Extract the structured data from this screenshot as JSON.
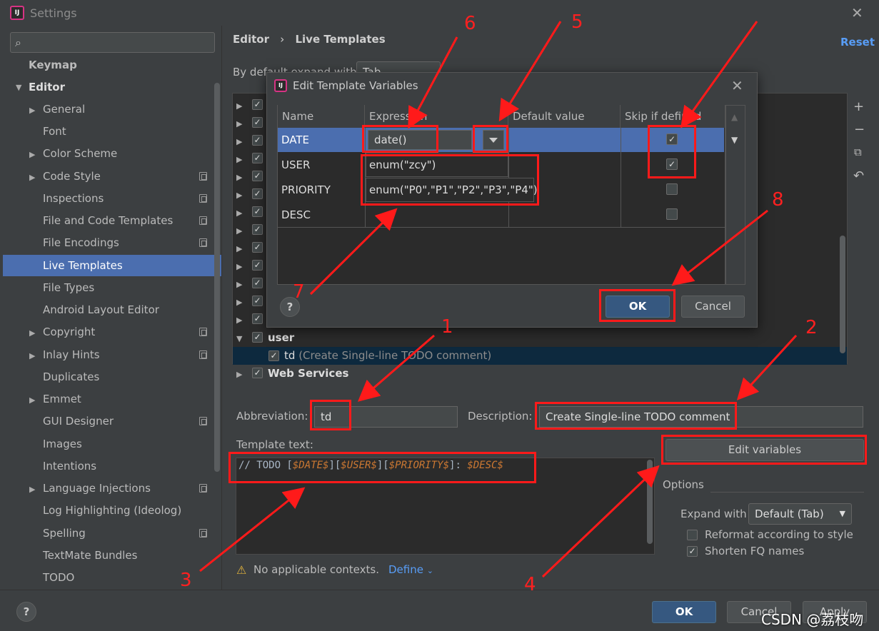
{
  "window": {
    "title": "Settings"
  },
  "sidebar": {
    "search_placeholder": "",
    "items": [
      {
        "label": "Keymap"
      },
      {
        "label": "Editor"
      },
      {
        "label": "General"
      },
      {
        "label": "Font"
      },
      {
        "label": "Color Scheme"
      },
      {
        "label": "Code Style"
      },
      {
        "label": "Inspections"
      },
      {
        "label": "File and Code Templates"
      },
      {
        "label": "File Encodings"
      },
      {
        "label": "Live Templates"
      },
      {
        "label": "File Types"
      },
      {
        "label": "Android Layout Editor"
      },
      {
        "label": "Copyright"
      },
      {
        "label": "Inlay Hints"
      },
      {
        "label": "Duplicates"
      },
      {
        "label": "Emmet"
      },
      {
        "label": "GUI Designer"
      },
      {
        "label": "Images"
      },
      {
        "label": "Intentions"
      },
      {
        "label": "Language Injections"
      },
      {
        "label": "Log Highlighting (Ideolog)"
      },
      {
        "label": "Spelling"
      },
      {
        "label": "TextMate Bundles"
      },
      {
        "label": "TODO"
      }
    ]
  },
  "header": {
    "crumb_parent": "Editor",
    "crumb_sep": "›",
    "crumb_current": "Live Templates",
    "reset": "Reset"
  },
  "expand_default": {
    "label": "By default expand with",
    "value": "Tab"
  },
  "template_list": {
    "group_user": "user",
    "item_abbrev": "td",
    "item_desc": "(Create Single-line TODO comment)",
    "group_web": "Web Services"
  },
  "dialog": {
    "title": "Edit Template Variables",
    "columns": [
      "Name",
      "Expression",
      "Default value",
      "Skip if defined"
    ],
    "rows": [
      {
        "name": "DATE",
        "expression": "date()",
        "skip": "✓"
      },
      {
        "name": "USER",
        "expression": "enum(\"zcy\")",
        "skip": "✓"
      },
      {
        "name": "PRIORITY",
        "expression": "enum(\"P0\",\"P1\",\"P2\",\"P3\",\"P4\")",
        "skip": ""
      },
      {
        "name": "DESC",
        "expression": "",
        "skip": ""
      }
    ],
    "ok": "OK",
    "cancel": "Cancel",
    "help": "?"
  },
  "form": {
    "abbreviation_label": "Abbreviation:",
    "abbreviation_value": "td",
    "description_label": "Description:",
    "description_value": "Create Single-line TODO comment",
    "template_text_label": "Template text:",
    "tmpl_prefix": "// TODO [",
    "tmpl_var_date": "$DATE$",
    "tmpl_mid1": "][",
    "tmpl_var_user": "$USER$",
    "tmpl_mid2": "][",
    "tmpl_var_priority": "$PRIORITY$",
    "tmpl_mid3": "]: ",
    "tmpl_var_desc": "$DESC$",
    "edit_variables": "Edit variables",
    "options_label": "Options",
    "expand_with_label": "Expand with",
    "expand_with_value": "Default (Tab)",
    "reformat": "Reformat according to style",
    "reformat_checked": "",
    "shorten": "Shorten FQ names",
    "shorten_checked": "✓",
    "no_contexts": "No applicable contexts.",
    "define": "Define",
    "warn_icon": "⚠"
  },
  "footer": {
    "ok": "OK",
    "cancel": "Cancel",
    "apply": "Apply",
    "help": "?"
  },
  "annotations": [
    "1",
    "2",
    "3",
    "4",
    "5",
    "6",
    "7",
    "8"
  ],
  "watermark": "CSDN @荔枝吻",
  "colors": {
    "selection": "#4b6eaf",
    "annotation": "#ff1a1a",
    "link": "#589df6"
  }
}
